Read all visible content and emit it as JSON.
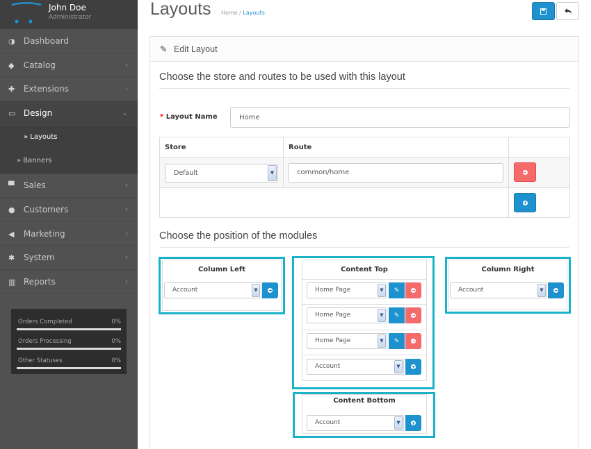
{
  "profile": {
    "name": "John Doe",
    "role": "Administrator"
  },
  "nav": {
    "items": [
      {
        "icon": "dashboard-icon",
        "label": "Dashboard"
      },
      {
        "icon": "tag-icon",
        "label": "Catalog"
      },
      {
        "icon": "puzzle-icon",
        "label": "Extensions"
      },
      {
        "icon": "desktop-icon",
        "label": "Design"
      },
      {
        "icon": "cart-icon",
        "label": "Sales"
      },
      {
        "icon": "user-icon",
        "label": "Customers"
      },
      {
        "icon": "share-icon",
        "label": "Marketing"
      },
      {
        "icon": "cog-icon",
        "label": "System"
      },
      {
        "icon": "bar-chart-icon",
        "label": "Reports"
      }
    ],
    "sub": [
      {
        "label": "» Layouts"
      },
      {
        "label": "» Banners"
      }
    ]
  },
  "stats": [
    {
      "label": "Orders Completed",
      "pct": "0%",
      "value": 0
    },
    {
      "label": "Orders Processing",
      "pct": "0%",
      "value": 0
    },
    {
      "label": "Other Statuses",
      "pct": "0%",
      "value": 0
    }
  ],
  "header": {
    "title": "Layouts",
    "breadcrumb": {
      "home": "Home",
      "sep": " / ",
      "current": "Layouts"
    }
  },
  "panel": {
    "heading": "Edit Layout",
    "legend1": "Choose the store and routes to be used with this layout",
    "layout_name_label": "Layout Name",
    "layout_name_required": "*",
    "layout_name_value": "Home",
    "route_table": {
      "headers": {
        "store": "Store",
        "route": "Route"
      },
      "row": {
        "store": "Default",
        "route": "common/home"
      }
    },
    "legend2": "Choose the position of the modules",
    "modules": {
      "column_left": {
        "title": "Column Left",
        "add_select": "Account"
      },
      "content_top": {
        "title": "Content Top",
        "rows": [
          "Home Page",
          "Home Page",
          "Home Page"
        ],
        "add_select": "Account"
      },
      "column_right": {
        "title": "Column Right",
        "add_select": "Account"
      },
      "content_bottom": {
        "title": "Content Bottom",
        "add_select": "Account"
      }
    }
  },
  "colors": {
    "accent": "#1e91cf",
    "danger": "#f56b6b",
    "highlight": "#1ab2c8",
    "sidebar": "#515151"
  }
}
